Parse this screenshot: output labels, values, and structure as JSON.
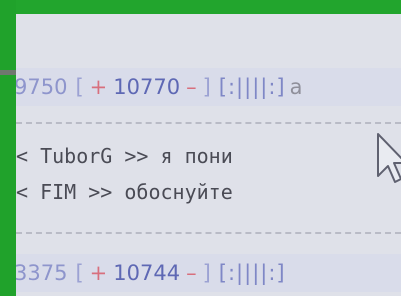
{
  "top_entry": {
    "id": "9750",
    "open_bracket": "[",
    "plus": "+",
    "score": "10770",
    "minus": "–",
    "close_bracket": "]",
    "rating_bar": "[:||||:]",
    "trailing": "a"
  },
  "quote_lines": [
    "< TuborG >> я пони",
    "< FIM >> обоснуйте"
  ],
  "bottom_entry": {
    "id": "3375",
    "open_bracket": "[",
    "plus": "+",
    "score": "10744",
    "minus": "–",
    "close_bracket": "]",
    "rating_bar": "[:||||:]"
  },
  "colors": {
    "frame": "#20a22b",
    "page": "#dfe1e9",
    "vote": "#d86f7d",
    "score": "#5e68b4"
  },
  "icons": [
    "mouse-pointer-icon"
  ]
}
